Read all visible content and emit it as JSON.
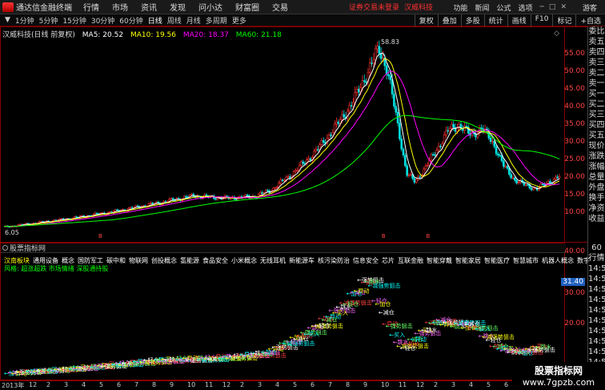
{
  "menubar": {
    "app_title": "通达信金融终端",
    "menus": [
      "行情",
      "市场",
      "资讯",
      "发现",
      "问小达",
      "财富圈",
      "交易"
    ],
    "warning": "证券交易未登录",
    "stock_name": "汉威科技",
    "right_items": [
      "功能",
      "新闻",
      "公式",
      "选项"
    ],
    "guest": "游客"
  },
  "periods": [
    "日线",
    "1分钟",
    "5分钟",
    "15分钟",
    "30分钟",
    "60分钟",
    "日线",
    "周线",
    "月线",
    "多周期",
    "更多"
  ],
  "period_active": "日线",
  "tools": [
    "复权",
    "叠加",
    "多股",
    "统计",
    "画线",
    "F10",
    "标记",
    "+自选"
  ],
  "info": {
    "name": "汉威科技(日线 前复权)",
    "ma5": "MA5: 20.52",
    "ma10": "MA10: 19.56",
    "ma20": "MA20: 18.37",
    "ma60": "MA60: 21.18"
  },
  "price_axis": [
    "55.00",
    "50.00",
    "45.00",
    "40.00",
    "35.00",
    "30.00",
    "25.00",
    "20.00",
    "15.00",
    "10.00"
  ],
  "peak_label": "58.83",
  "low_label": "6.05",
  "quote_panel": [
    "委比",
    "卖五",
    "卖四",
    "卖三",
    "卖二",
    "卖一",
    "买一",
    "买二",
    "买三",
    "买四",
    "买五",
    "现价",
    "涨跌",
    "涨幅",
    "总量",
    "外盘",
    "换手",
    "净资",
    "收益"
  ],
  "indicator": {
    "title": "股票指标网",
    "concepts": [
      "汉南板块",
      "通用设备",
      "概念",
      "国防军工",
      "碳中和",
      "物联网",
      "创投概念",
      "氢能源",
      "食品安全",
      "小米概念",
      "无线耳机",
      "新能源车",
      "核污染防治",
      "信息安全",
      "芯片",
      "互联金融",
      "智能穿戴",
      "智能家居",
      "智能医疗",
      "智慧城市",
      "机器人概念",
      "数字"
    ],
    "risk_line": "风格: 超涨超跌  市场情绪  深股通持股",
    "axis": [
      "40.00",
      "31.40",
      "30.00",
      "20.00"
    ],
    "axis_highlight": "31.40",
    "right_panel": [
      "60",
      "行情",
      "14:5",
      "14:5",
      "14:5",
      "14:5",
      "14:5",
      "14:5",
      "14:5",
      "14:5",
      "14:5",
      "14:5",
      "14:5"
    ],
    "signals": {
      "add": "加仓",
      "reduce": "减仓",
      "move": "异动",
      "trend": "强势狙击",
      "buy": "买入",
      "dive": "跳水",
      "reduce_trend": "减强势狙击",
      "light": "轻仓"
    }
  },
  "date_axis": [
    "2013年",
    "12",
    "2",
    "3",
    "4",
    "5",
    "6",
    "7",
    "8",
    "9",
    "10",
    "11",
    "12",
    "2",
    "3",
    "4",
    "5",
    "6",
    "7",
    "8",
    "9",
    "10",
    "11",
    "12",
    "2",
    "3",
    "4",
    "5",
    "6",
    "7",
    "8"
  ],
  "watermark": {
    "line1": "股票指标网",
    "line2": "www.7gpzb.com"
  },
  "colors": {
    "up": "#ff3030",
    "down": "#00e0e0",
    "ma5": "#ffffff",
    "ma10": "#ffff00",
    "ma20": "#ff00ff",
    "ma60": "#00ff00",
    "border": "#800000"
  }
}
